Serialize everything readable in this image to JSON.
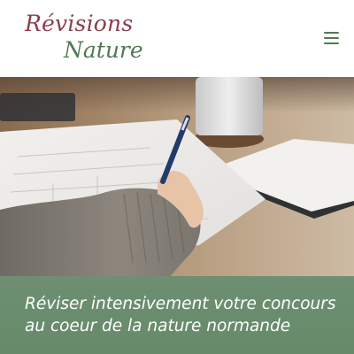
{
  "header": {
    "logo_line1": "Révisions",
    "logo_line2": "Nature",
    "menu_icon": "hamburger-menu-icon"
  },
  "hero": {
    "image": "person-writing-on-notebook-with-pen-at-desk"
  },
  "tagline": {
    "line1": "Réviser intensivement votre concours",
    "line2": "au coeur de la nature normande"
  },
  "colors": {
    "logo_red": "#8a3f4a",
    "logo_green": "#4f7a54",
    "band_green": "#6a8c6e"
  }
}
